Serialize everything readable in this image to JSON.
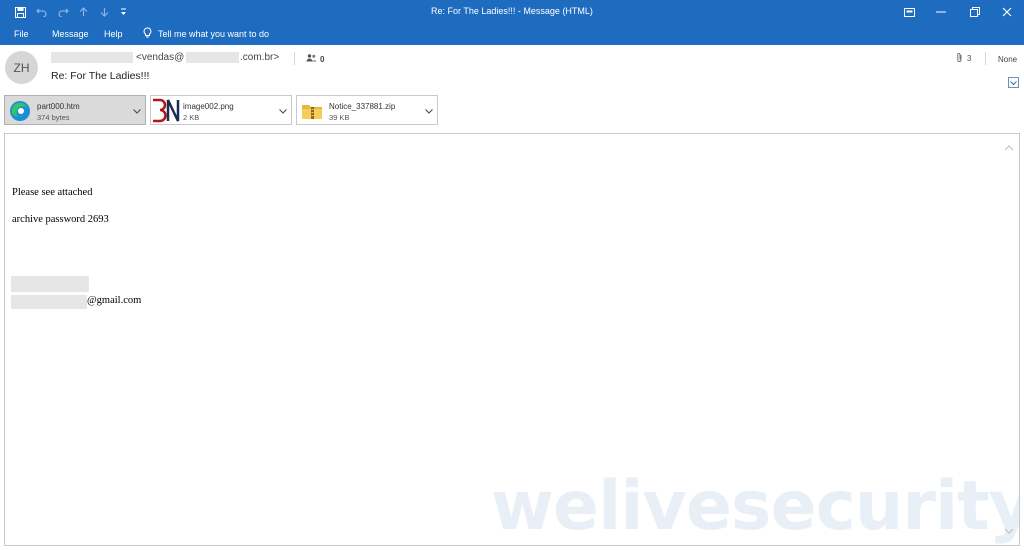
{
  "window": {
    "title": "Re: For The Ladies!!!  -  Message (HTML)"
  },
  "ribbon": {
    "tabs": [
      "File",
      "Message",
      "Help"
    ],
    "tell_me": "Tell me what you want to do"
  },
  "header": {
    "avatar_initials": "ZH",
    "sender_prefix": "<vendas@",
    "sender_suffix": ".com.br>",
    "people_count": "0",
    "subject": "Re: For The Ladies!!!",
    "attachment_count": "3",
    "flag_label": "None"
  },
  "attachments": [
    {
      "name": "part000.htm",
      "size": "374 bytes",
      "icon": "edge-icon"
    },
    {
      "name": "image002.png",
      "size": "2 KB",
      "icon": "image-thumbnail-icon"
    },
    {
      "name": "Notice_337881.zip",
      "size": "39 KB",
      "icon": "zip-folder-icon"
    }
  ],
  "body": {
    "line1": "Please see attached",
    "line2": "archive password 2693",
    "email_suffix": "@gmail.com"
  },
  "watermark": "welivesecurity",
  "colors": {
    "accent": "#1e6cc0",
    "watermark": "#e9eff6"
  }
}
